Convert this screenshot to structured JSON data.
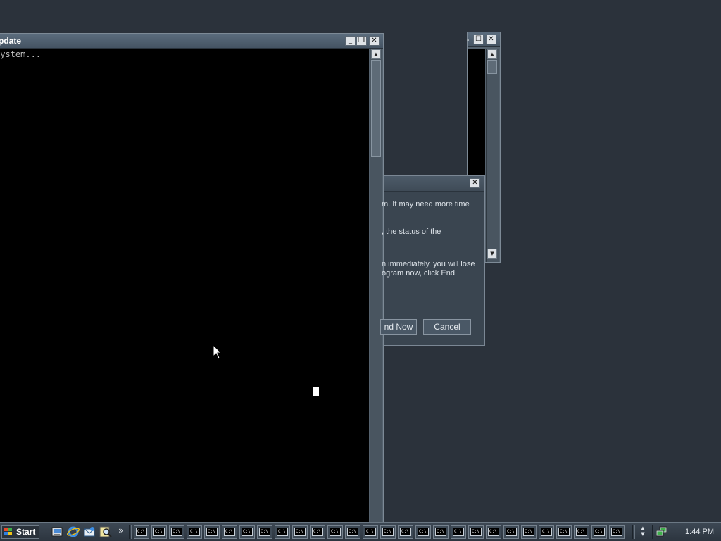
{
  "console": {
    "title": "pdate",
    "line1": "system...",
    "buttons": {
      "minimize": "_",
      "restore": "❐",
      "close": "✕"
    }
  },
  "console2": {
    "title": ".",
    "buttons": {
      "maximize": "☐",
      "close": "✕"
    }
  },
  "dialog": {
    "close": "✕",
    "lines": [
      "m. It may need more time",
      ", the status of the",
      "n immediately, you will lose",
      "ogram now, click End"
    ],
    "end_now_label": "nd Now",
    "cancel_label": "Cancel"
  },
  "taskbar": {
    "start_label": "Start",
    "overflow_chevron": "»",
    "task_icon_text": "C:\\",
    "task_count": 28,
    "clock": "1:44 PM"
  },
  "colors": {
    "desktop": "#2b323b",
    "titlebar": "#4f5e6d",
    "console_bg": "#000000"
  },
  "icons": {
    "quick_launch": [
      "show-desktop-icon",
      "internet-explorer-icon",
      "outlook-express-icon",
      "search-icon"
    ],
    "tray": [
      "network-icon"
    ]
  }
}
